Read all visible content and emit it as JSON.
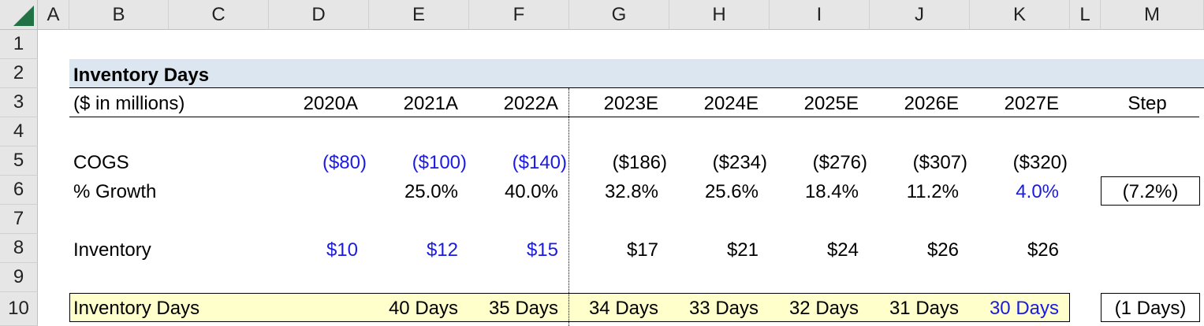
{
  "columns": [
    "A",
    "B",
    "C",
    "D",
    "E",
    "F",
    "G",
    "H",
    "I",
    "J",
    "K",
    "L",
    "M"
  ],
  "rows": [
    "1",
    "2",
    "3",
    "4",
    "5",
    "6",
    "7",
    "8",
    "9",
    "10"
  ],
  "title": "Inventory Days",
  "header": {
    "units": "($ in millions)",
    "years": [
      "2020A",
      "2021A",
      "2022A",
      "2023E",
      "2024E",
      "2025E",
      "2026E",
      "2027E"
    ],
    "step": "Step"
  },
  "cogs": {
    "label": "COGS",
    "values": [
      "($80)",
      "($100)",
      "($140)",
      "($186)",
      "($234)",
      "($276)",
      "($307)",
      "($320)"
    ]
  },
  "growth": {
    "label": "% Growth",
    "values": [
      "",
      "25.0%",
      "40.0%",
      "32.8%",
      "25.6%",
      "18.4%",
      "11.2%",
      "4.0%"
    ],
    "step": "(7.2%)"
  },
  "inventory": {
    "label": "Inventory",
    "values": [
      "$10",
      "$12",
      "$15",
      "$17",
      "$21",
      "$24",
      "$26",
      "$26"
    ]
  },
  "inventory_days": {
    "label": "Inventory Days",
    "values": [
      "",
      "40 Days",
      "35 Days",
      "34 Days",
      "33 Days",
      "32 Days",
      "31 Days",
      "30 Days"
    ],
    "step": "(1 Days)"
  },
  "colors": {
    "input_blue": "#1a1ae6",
    "title_fill": "#dce6f1",
    "days_fill": "#ffffcc",
    "excel_green": "#217346"
  }
}
